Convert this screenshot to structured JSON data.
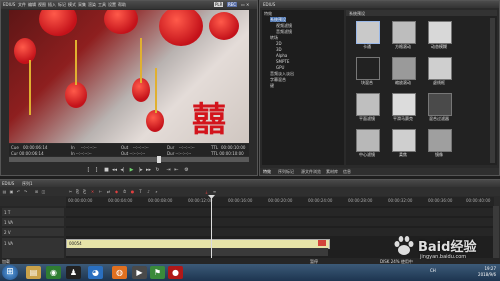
{
  "player": {
    "title": "EDIUS",
    "menu": [
      "文件",
      "编辑",
      "视图",
      "插入",
      "标记",
      "模式",
      "采集",
      "渲染",
      "工具",
      "设置",
      "帮助"
    ],
    "mode_badge": "PLR",
    "mode_badge2": "REC",
    "cue_label": "Cue",
    "cue_time": "00:00:06:14",
    "in_label": "In",
    "in_time": "--:--:--:--",
    "out_label": "Out",
    "out_time": "--:--:--:--",
    "dur_label": "Dur",
    "dur_time": "--:--:--:--",
    "ttl_label": "TTL",
    "ttl_time": "00:00:10:00",
    "row2_left": "Cur 00:00:06:14",
    "row2_in": "In --:--:--:--",
    "row2_out": "Out --:--:--:--",
    "row2_dur": "Dur --:--:--:--",
    "row2_ttl": "TTL 00:00:10:00",
    "big_text": "囍"
  },
  "effects": {
    "title": "EDIUS",
    "tree": [
      {
        "label": "特效",
        "indent": 0
      },
      {
        "label": "系统预设",
        "indent": 1,
        "selected": true
      },
      {
        "label": "视频滤镜",
        "indent": 2
      },
      {
        "label": "音频滤镜",
        "indent": 2
      },
      {
        "label": "转场",
        "indent": 1
      },
      {
        "label": "2D",
        "indent": 2
      },
      {
        "label": "3D",
        "indent": 2
      },
      {
        "label": "Alpha",
        "indent": 2
      },
      {
        "label": "SMPTE",
        "indent": 2
      },
      {
        "label": "GPU",
        "indent": 2
      },
      {
        "label": "音频淡入淡出",
        "indent": 1
      },
      {
        "label": "字幕混合",
        "indent": 1
      },
      {
        "label": "键",
        "indent": 1
      }
    ],
    "gallery_header": "系统预设",
    "items": [
      {
        "label": "卡通",
        "thumb": "#c9c9c9",
        "selected": true
      },
      {
        "label": "方格滚动",
        "thumb": "#bdbdbd"
      },
      {
        "label": "动态模糊",
        "thumb": "#d8d8d8"
      },
      {
        "label": "块混合",
        "thumb": "#222222"
      },
      {
        "label": "缩放滚动",
        "thumb": "#9a9a9a"
      },
      {
        "label": "虚线框",
        "thumb": "#cfcfcf"
      },
      {
        "label": "平面滤镜",
        "thumb": "#bfbfbf"
      },
      {
        "label": "平滑马赛克",
        "thumb": "#dcdcdc"
      },
      {
        "label": "混合过滤器",
        "thumb": "#4a4a4a"
      },
      {
        "label": "中心滤镜",
        "thumb": "#b8b8b8"
      },
      {
        "label": "柔焦",
        "thumb": "#cfcfcf"
      },
      {
        "label": "镜像",
        "thumb": "#9f9f9f"
      }
    ],
    "tabs": [
      "特效",
      "序列标记",
      "源文件浏览",
      "素材库",
      "信息"
    ]
  },
  "timeline": {
    "title": "EDIUS",
    "sequence": "序列1",
    "ruler": [
      "00:00:00:00",
      "00:00:04:00",
      "00:00:08:00",
      "00:00:12:00",
      "00:00:16:00",
      "00:00:20:00",
      "00:00:24:00",
      "00:00:28:00",
      "00:00:32:00",
      "00:00:36:00",
      "00:00:40:00"
    ],
    "tracks": [
      {
        "name": "1 T"
      },
      {
        "name": "1 VA"
      },
      {
        "name": "2 V"
      },
      {
        "name": "1 VA"
      }
    ],
    "clip_label": "00054",
    "status_left": "加载",
    "status_mid": "暂停",
    "status_right": "DISK 24% 使用中"
  },
  "taskbar": {
    "start_icon": "windows-orb",
    "apps": [
      "folder-icon",
      "chrome-icon",
      "qq-icon",
      "penguin-icon",
      "firefox-icon",
      "edius-icon",
      "flag-icon",
      "record-icon"
    ],
    "tray_text": "CH",
    "time": "19:27",
    "date": "2018/9/6"
  },
  "watermark": {
    "main": "Baid经验",
    "sub": "jingyan.baidu.com"
  }
}
